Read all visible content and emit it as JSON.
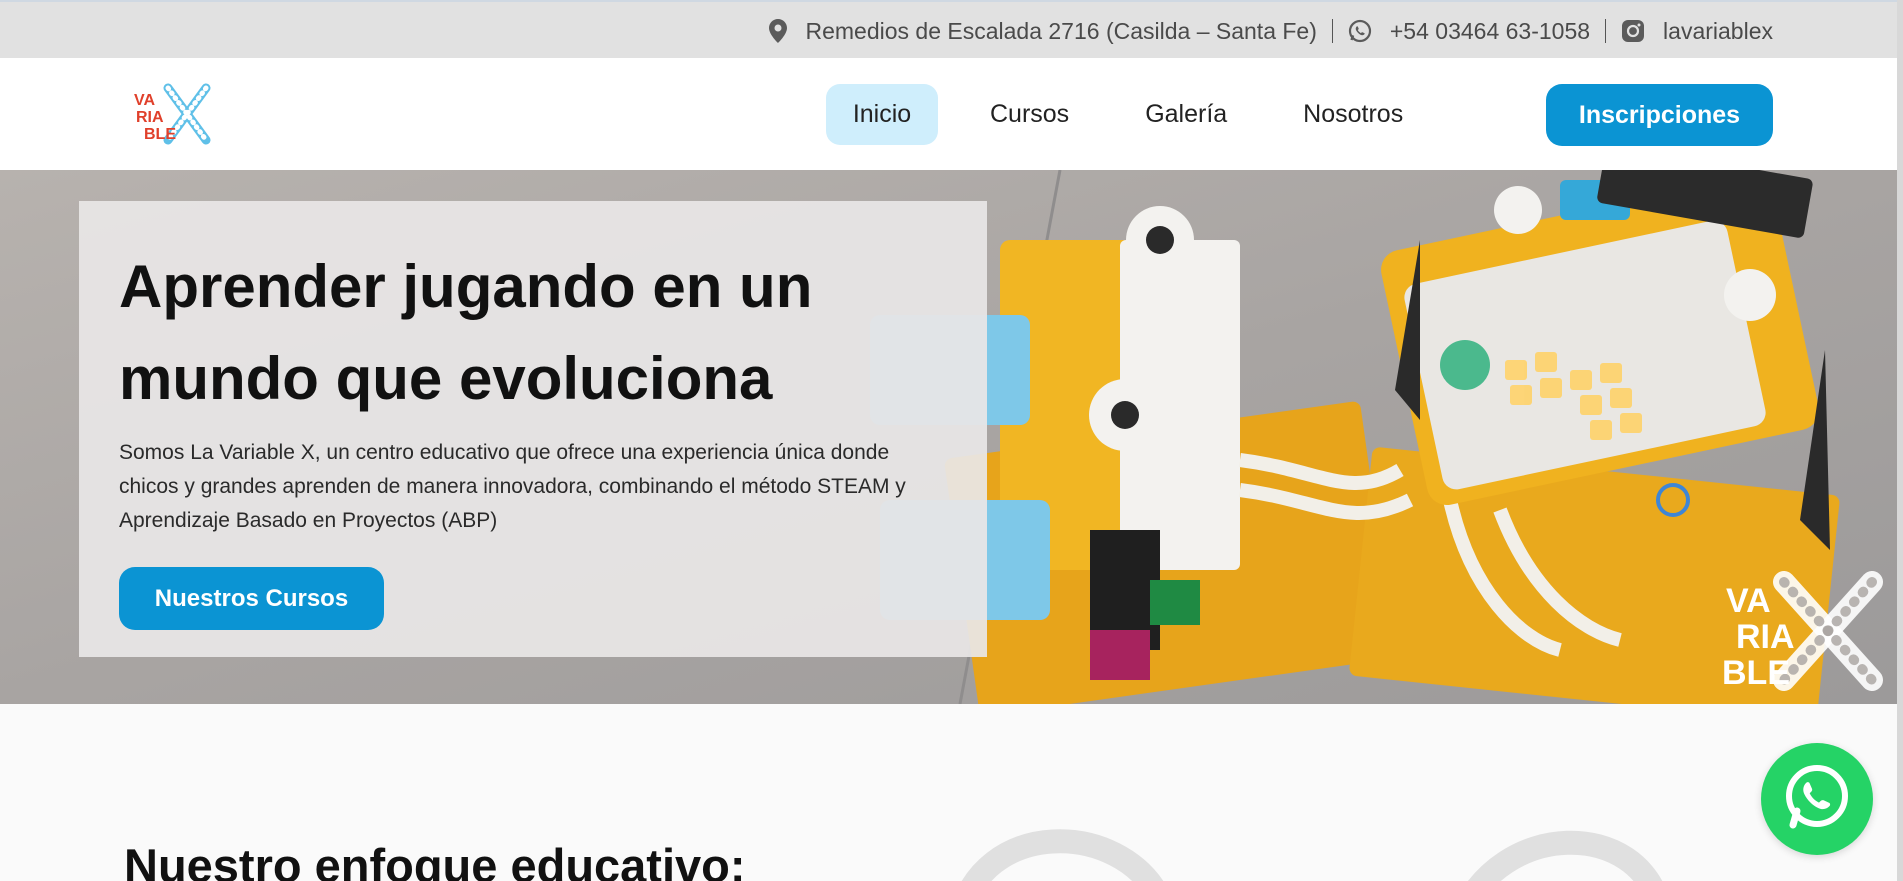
{
  "topbar": {
    "address": "Remedios de Escalada 2716 (Casilda – Santa Fe)",
    "phone": "+54 03464 63-1058",
    "instagram": "lavariablex"
  },
  "header": {
    "logo_text": [
      "VA",
      "RIA",
      "BLE"
    ],
    "nav": [
      {
        "label": "Inicio",
        "active": true
      },
      {
        "label": "Cursos",
        "active": false
      },
      {
        "label": "Galería",
        "active": false
      },
      {
        "label": "Nosotros",
        "active": false
      }
    ],
    "cta_label": "Inscripciones"
  },
  "hero": {
    "title": "Aprender jugando en un mundo que evoluciona",
    "text": "Somos La Variable X, un centro educativo que ofrece una experiencia única donde chicos y grandes aprenden de manera innovadora, combinando el método STEAM y Aprendizaje Basado en Proyectos (ABP)",
    "button_label": "Nuestros Cursos"
  },
  "section": {
    "heading": "Nuestro enfoque educativo:"
  },
  "colors": {
    "accent": "#0b94d3",
    "nav_active_bg": "#cfeefc",
    "logo_red": "#e0402b",
    "logo_blue": "#5fc0e8",
    "whatsapp": "#25d366"
  },
  "icons": [
    "location-pin-icon",
    "whatsapp-icon",
    "instagram-icon",
    "whatsapp-float-icon"
  ]
}
